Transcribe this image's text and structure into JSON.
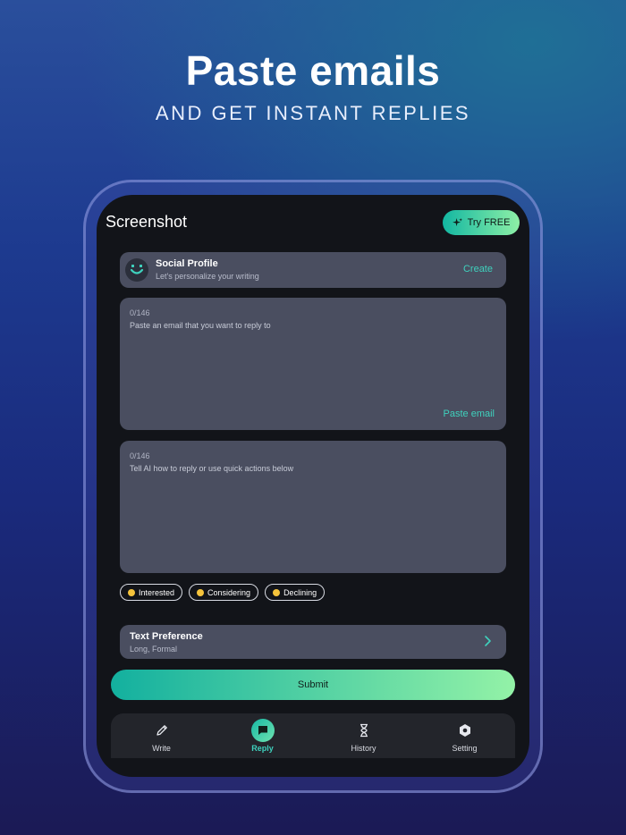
{
  "hero": {
    "title": "Paste emails",
    "subtitle": "AND GET INSTANT REPLIES"
  },
  "header": {
    "title": "Screenshot",
    "try_label": "Try FREE"
  },
  "profile": {
    "title": "Social Profile",
    "subtitle": "Let's personalize your writing",
    "action": "Create"
  },
  "email_input": {
    "counter": "0/146",
    "placeholder": "Paste an email that you want to reply to",
    "action": "Paste email"
  },
  "instruction_input": {
    "counter": "0/146",
    "placeholder": "Tell AI how to reply or use quick actions below"
  },
  "quick_actions": [
    "Interested",
    "Considering",
    "Declining"
  ],
  "preference": {
    "title": "Text Preference",
    "value": "Long, Formal"
  },
  "submit_label": "Submit",
  "tabs": [
    {
      "label": "Write",
      "icon": "pencil-icon",
      "active": false
    },
    {
      "label": "Reply",
      "icon": "chat-icon",
      "active": true
    },
    {
      "label": "History",
      "icon": "hourglass-icon",
      "active": false
    },
    {
      "label": "Setting",
      "icon": "gear-icon",
      "active": false
    }
  ],
  "colors": {
    "accent": "#3fd1bd",
    "gradient_start": "#13b09f",
    "gradient_end": "#93f2a7",
    "card": "#4a4e60",
    "screen_bg": "#121419"
  }
}
